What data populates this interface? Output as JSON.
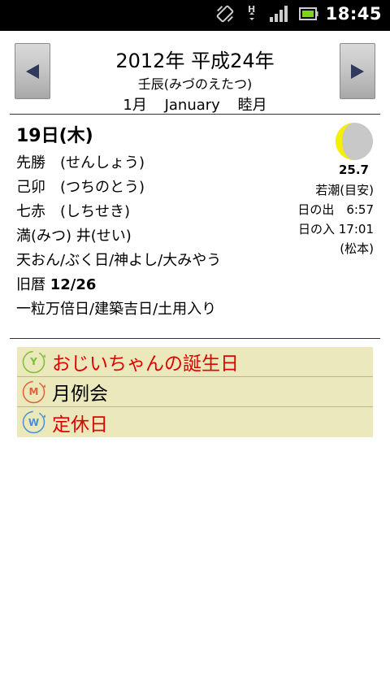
{
  "status_bar": {
    "clock": "18:45",
    "icons": [
      "vibrate-icon",
      "hspa-data-icon",
      "signal-strength-icon",
      "battery-icon"
    ]
  },
  "header": {
    "year_line": "2012年 平成24年",
    "kanshi_line": "壬辰(みづのえたつ)",
    "month_number": "1月",
    "month_english": "January",
    "month_japanese": "睦月"
  },
  "day": {
    "title": "19日(木)",
    "rokuyo": "先勝　(せんしょう)",
    "eto": "己卯　(つちのとう)",
    "kyusei": "七赤　(しちせき)",
    "choku_shuku": "満(みつ) 井(せい)",
    "kichijitsu": "天おん/ぶく日/神よし/大みやう",
    "kyureki_label": "旧暦 ",
    "kyureki_value": "12/26",
    "special_days": "一粒万倍日/建築吉日/土用入り"
  },
  "moon": {
    "age": "25.7",
    "tide": "若潮(目安)",
    "sunrise": "日の出　6:57",
    "sunset": "日の入 17:01",
    "location": "(松本)"
  },
  "events": [
    {
      "badge": "Y",
      "label": "おじいちゃんの誕生日",
      "color": "#e00000",
      "badge_color": "#7bbf3a"
    },
    {
      "badge": "M",
      "label": "月例会",
      "color": "#000000",
      "badge_color": "#e0623a"
    },
    {
      "badge": "W",
      "label": "定休日",
      "color": "#e00000",
      "badge_color": "#4a8fd9"
    }
  ],
  "colors": {
    "event_background": "#ebe8bb",
    "moon_lit": "#f5f000",
    "moon_dark": "#c8c8c8"
  }
}
